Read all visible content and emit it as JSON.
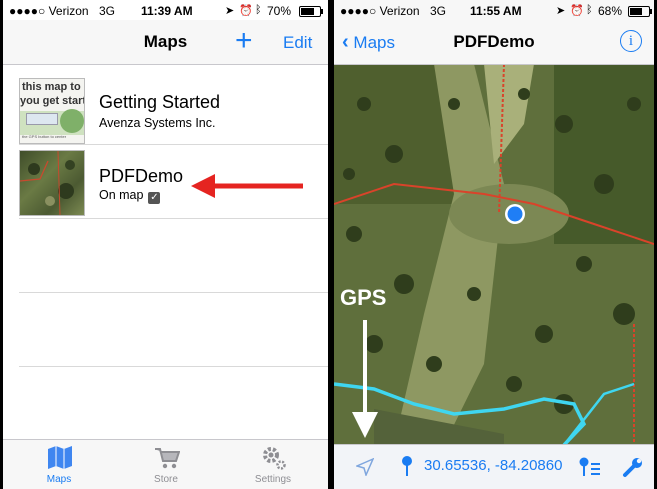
{
  "left_screen": {
    "status": {
      "carrier": "●●●●○ Verizon",
      "network": "3G",
      "time": "11:39 AM",
      "battery": "70%",
      "battery_level": 0.7
    },
    "nav": {
      "title": "Maps",
      "add_label": "+",
      "edit_label": "Edit"
    },
    "maps": [
      {
        "title": "Getting Started",
        "subtitle": "Avenza Systems Inc.",
        "thumb_line1": "this map to",
        "thumb_line2": "you get starte",
        "thumb_small": "the GPS button to center"
      },
      {
        "title": "PDFDemo",
        "subtitle": "On map",
        "checkmark": "✓"
      }
    ],
    "tabs": [
      {
        "label": "Maps",
        "icon": "maps-icon",
        "active": true
      },
      {
        "label": "Store",
        "icon": "cart-icon",
        "active": false
      },
      {
        "label": "Settings",
        "icon": "gear-icon",
        "active": false
      }
    ]
  },
  "right_screen": {
    "status": {
      "carrier": "●●●●○ Verizon",
      "network": "3G",
      "time": "11:55 AM",
      "battery": "68%",
      "battery_level": 0.68
    },
    "nav": {
      "back_label": "Maps",
      "title": "PDFDemo",
      "info_icon": "info-icon"
    },
    "annotation": {
      "label": "GPS"
    },
    "toolbar": {
      "coordinates": "30.65536, -84.20860"
    }
  },
  "colors": {
    "ios_blue": "#1a7cf2",
    "arrow_red": "#e52421",
    "map_border_red": "#d9432a",
    "river_cyan": "#3fd6f0",
    "location_dot": "#1f7ef5"
  }
}
